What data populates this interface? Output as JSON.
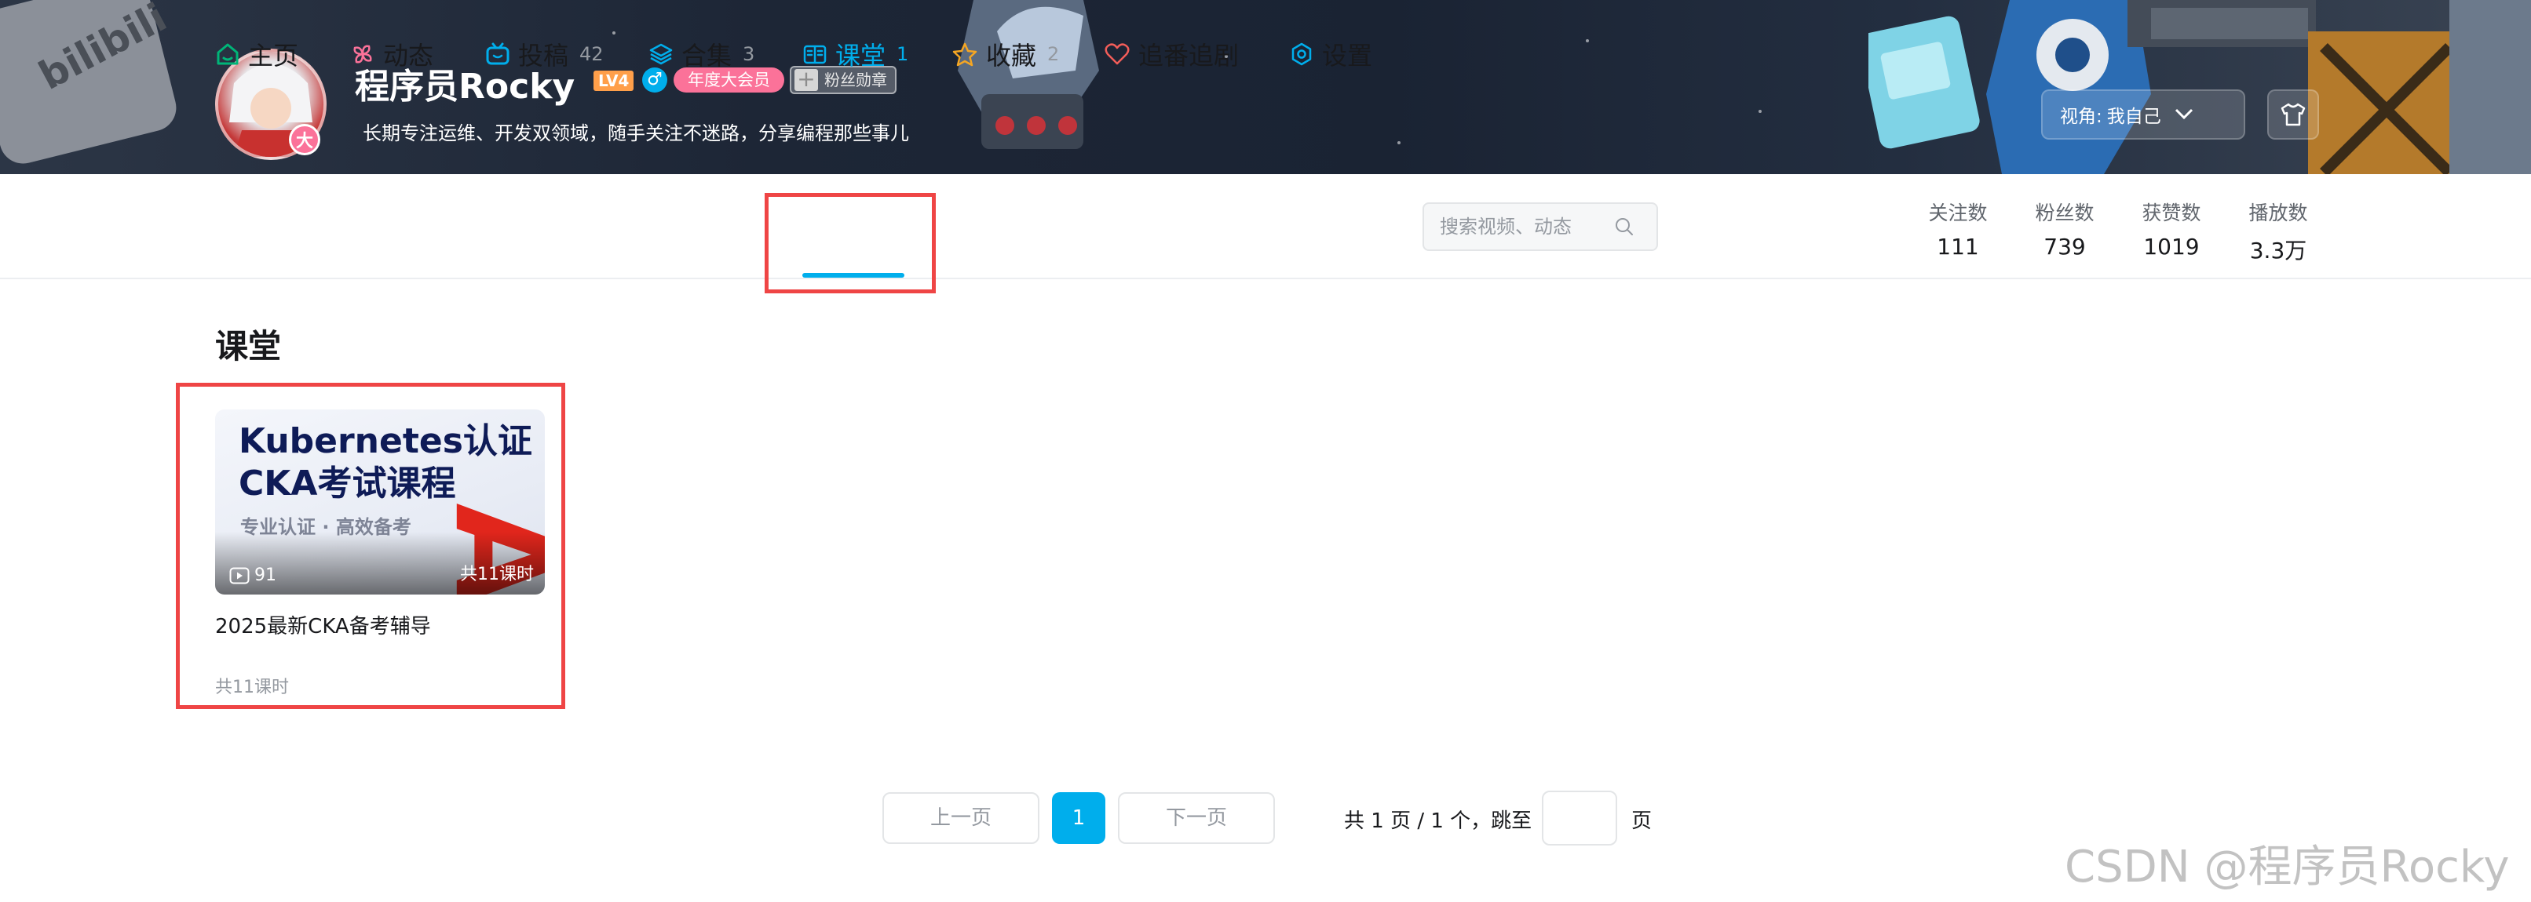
{
  "header": {
    "logo_text": "bilibili",
    "username": "程序员Rocky",
    "level_badge": "LV4",
    "gender_symbol": "♂",
    "vip_label": "年度大会员",
    "medal_label": "粉丝勋章",
    "avatar_badge": "大",
    "signature": "长期专注运维、开发双领域，随手关注不迷路，分享编程那些事儿",
    "view_prefix": "视角:",
    "view_value": "我自己"
  },
  "nav": {
    "items": [
      {
        "label": "主页",
        "count": "",
        "icon": "home-icon"
      },
      {
        "label": "动态",
        "count": "",
        "icon": "pinwheel-icon"
      },
      {
        "label": "投稿",
        "count": "42",
        "icon": "tv-icon"
      },
      {
        "label": "合集",
        "count": "3",
        "icon": "layers-icon"
      },
      {
        "label": "课堂",
        "count": "1",
        "icon": "book-icon"
      },
      {
        "label": "收藏",
        "count": "2",
        "icon": "star-icon"
      },
      {
        "label": "追番追剧",
        "count": "",
        "icon": "heart-icon"
      },
      {
        "label": "设置",
        "count": "",
        "icon": "settings-icon"
      }
    ],
    "search_placeholder": "搜索视频、动态"
  },
  "stats": [
    {
      "title": "关注数",
      "value": "111"
    },
    {
      "title": "粉丝数",
      "value": "739"
    },
    {
      "title": "获赞数",
      "value": "1019"
    },
    {
      "title": "播放数",
      "value": "3.3万"
    }
  ],
  "section": {
    "title": "课堂"
  },
  "course": {
    "cover_line1": "Kubernetes认证",
    "cover_line2": "CKA考试课程",
    "cover_sub": "专业认证 · 高效备考",
    "cover_mark": "A",
    "plays": "91",
    "lessons_cover": "共11课时",
    "title": "2025最新CKA备考辅导",
    "lessons": "共11课时"
  },
  "pagination": {
    "prev": "上一页",
    "current": "1",
    "next": "下一页",
    "info": "共 1 页 / 1 个，跳至",
    "unit": "页"
  },
  "watermark": "CSDN @程序员Rocky",
  "colors": {
    "accent": "#00aeec",
    "pink": "#fb7299",
    "highlight": "#ef4545"
  }
}
